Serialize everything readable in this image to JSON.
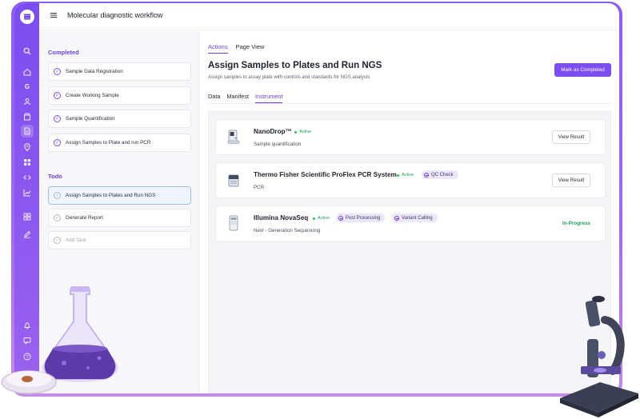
{
  "app": {
    "title": "Molecular diagnostic workflow"
  },
  "rail": {
    "icons": [
      "menu-icon",
      "search-icon",
      "home-icon",
      "google-icon",
      "users-icon",
      "box-icon",
      "document-icon",
      "location-icon",
      "grid-icon",
      "code-icon",
      "chart-icon",
      "apps-icon",
      "pen-icon",
      "bell-icon",
      "chat-icon",
      "help-icon"
    ]
  },
  "left": {
    "completed_heading": "Completed",
    "completed": [
      {
        "label": "Sample Data Registration"
      },
      {
        "label": "Create Working Sample"
      },
      {
        "label": "Sample Quantification"
      },
      {
        "label": "Assign Samples to Plate and run PCR"
      }
    ],
    "todo_heading": "Todo",
    "todo": [
      {
        "label": "Assign Samples to Plates and Run NGS"
      },
      {
        "label": "Generate Report"
      },
      {
        "label": "Add Task"
      }
    ]
  },
  "main": {
    "top_tabs": [
      "Actions",
      "Page View"
    ],
    "title": "Assign Samples to Plates and Run NGS",
    "subtitle": "Assign samples to assay plate with controls and standards for NGS analysis",
    "mark_button": "Mark as Completed",
    "sub_tabs": [
      "Data",
      "Manifest",
      "Instrument"
    ],
    "instruments": [
      {
        "name": "NanoDrop™",
        "status": "Active",
        "desc": "Sample quantification",
        "action": "View Result"
      },
      {
        "name": "Thermo Fisher Scientific ProFlex PCR System",
        "status": "Active",
        "chips": [
          "QC Check"
        ],
        "desc": "PCR",
        "action": "View Result"
      },
      {
        "name": "Illumina NovaSeq",
        "status": "Active",
        "chips": [
          "Post Processing",
          "Variant Calling"
        ],
        "desc": "Next - Generation Sequencing",
        "state": "In-Progress"
      }
    ]
  },
  "colors": {
    "accent": "#7c4df0",
    "success": "#1f9d55",
    "chip_bg": "#ece6fb"
  }
}
